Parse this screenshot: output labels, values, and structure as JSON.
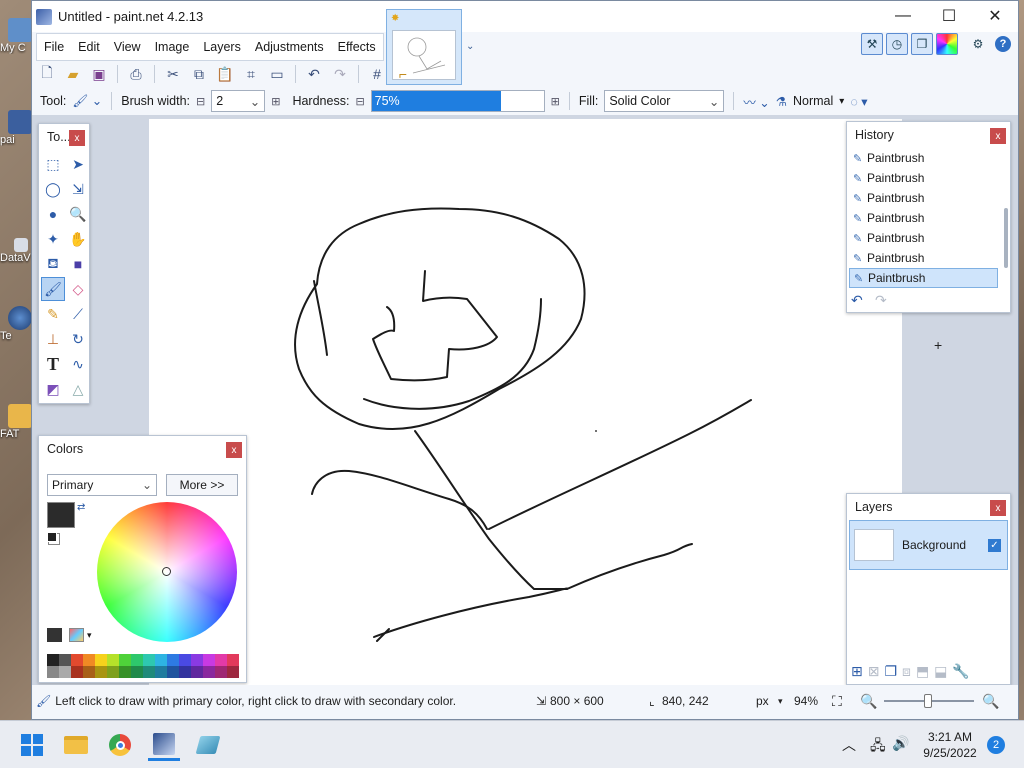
{
  "desktop": {
    "icons": [
      {
        "label": "My C"
      },
      {
        "label": "pai"
      },
      {
        "label": "DataV"
      },
      {
        "label": "Te"
      },
      {
        "label": "FAT"
      }
    ]
  },
  "window": {
    "title": "Untitled - paint.net 4.2.13",
    "controls": {
      "minimize": "—",
      "maximize": "☐",
      "close": "✕"
    }
  },
  "menu": [
    "File",
    "Edit",
    "View",
    "Image",
    "Layers",
    "Adjustments",
    "Effects"
  ],
  "toolbar": {
    "tool_label": "Tool:",
    "brush_width_label": "Brush width:",
    "brush_width_value": "2",
    "hardness_label": "Hardness:",
    "hardness_value": "75%",
    "hardness_level": 0.75,
    "fill_label": "Fill:",
    "fill_value": "Solid Color",
    "blend_mode": "Normal"
  },
  "tools_panel": {
    "title": "To...",
    "close": "x"
  },
  "colors_panel": {
    "title": "Colors",
    "close": "x",
    "selector_value": "Primary",
    "more_button": "More >>",
    "primary_color": "#2b2b2b",
    "secondary_color": "#ffffff"
  },
  "history_panel": {
    "title": "History",
    "close": "x",
    "items": [
      "Paintbrush",
      "Paintbrush",
      "Paintbrush",
      "Paintbrush",
      "Paintbrush",
      "Paintbrush",
      "Paintbrush"
    ]
  },
  "layers_panel": {
    "title": "Layers",
    "close": "x",
    "layers": [
      {
        "name": "Background",
        "visible": true
      }
    ]
  },
  "status": {
    "hint": "Left click to draw with primary color, right click to draw with secondary color.",
    "image_size": "800 × 600",
    "cursor_pos": "840, 242",
    "units": "px",
    "zoom": "94%"
  },
  "taskbar": {
    "time": "3:21 AM",
    "date": "9/25/2022",
    "notifications": "2"
  },
  "colors": {
    "accent": "#1f7ee0",
    "selection": "#cfe4fb",
    "close_red": "#c84c4c"
  }
}
